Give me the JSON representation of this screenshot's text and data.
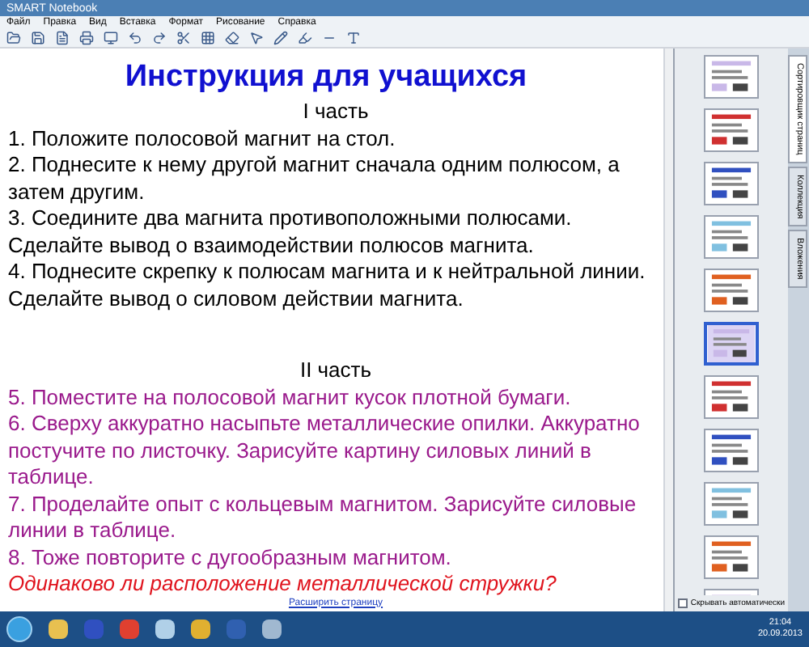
{
  "window": {
    "title": "SMART Notebook"
  },
  "menu": [
    "Файл",
    "Правка",
    "Вид",
    "Вставка",
    "Формат",
    "Рисование",
    "Справка"
  ],
  "page": {
    "heading": "Инструкция для учащихся",
    "sections": [
      {
        "title": "I часть",
        "items": [
          {
            "kind": "instruction",
            "text": "1.   Положите полосовой магнит на стол."
          },
          {
            "kind": "instruction",
            "text": "2.   Поднесите к нему другой магнит сначала одним полюсом, а затем другим."
          },
          {
            "kind": "instruction",
            "text": "3.   Соедините два магнита противоположными полюсами. Сделайте вывод о взаимодействии полюсов магнита."
          },
          {
            "kind": "instruction",
            "text": "4.   Поднесите скрепку к полюсам магнита и к нейтральной линии. Сделайте вывод о силовом действии магнита."
          }
        ]
      },
      {
        "title": "II часть",
        "items": [
          {
            "kind": "task",
            "text": "5.   Поместите на  полосовой магнит кусок плотной бумаги."
          },
          {
            "kind": "task",
            "text": "6.   Сверху аккуратно насыпьте металлические опилки. Аккуратно постучите по листочку. Зарисуйте картину силовых линий в таблице."
          },
          {
            "kind": "task",
            "text": "7.   Проделайте опыт с кольцевым магнитом. Зарисуйте силовые  линии в таблице."
          },
          {
            "kind": "task",
            "text": "8.   Тоже повторите с дугообразным магнитом."
          },
          {
            "kind": "question",
            "text": "Одинаково ли расположение металлической стружки?"
          }
        ]
      }
    ],
    "link": "Расширить страницу"
  },
  "sidebar": {
    "tabs": [
      {
        "label": "Сортировщик страниц",
        "selected": true
      },
      {
        "label": "Коллекция",
        "selected": false
      },
      {
        "label": "Вложения",
        "selected": false
      }
    ],
    "thumbnails": [
      {
        "selected": false
      },
      {
        "selected": false
      },
      {
        "selected": false
      },
      {
        "selected": false
      },
      {
        "selected": false
      },
      {
        "selected": true
      },
      {
        "selected": false
      },
      {
        "selected": false
      },
      {
        "selected": false
      },
      {
        "selected": false
      },
      {
        "selected": false
      }
    ],
    "auto_hide": {
      "label": "Скрывать автоматически",
      "checked": false
    }
  },
  "taskbar": {
    "time": "21:04",
    "date": "20.09.2013"
  }
}
